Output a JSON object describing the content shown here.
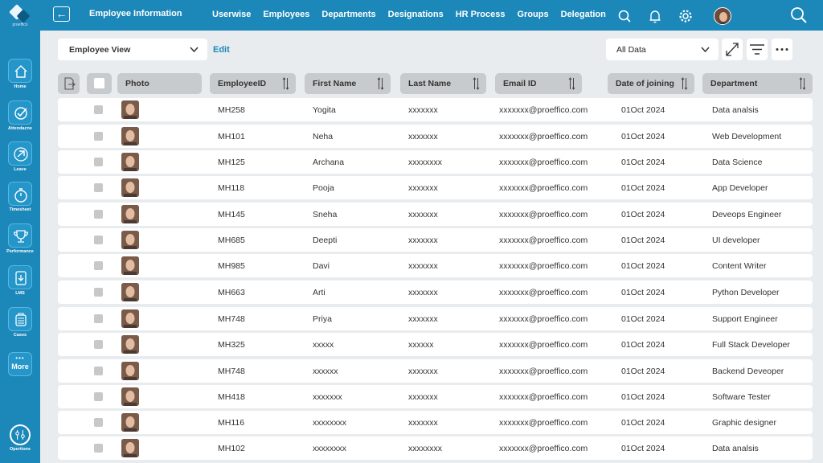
{
  "sidebar": {
    "logo_text": "proeffico",
    "items": [
      {
        "label": "Home",
        "icon": "home-icon"
      },
      {
        "label": "Attendacne",
        "icon": "attendance-check-icon"
      },
      {
        "label": "Leave",
        "icon": "plane-icon"
      },
      {
        "label": "Timesheet",
        "icon": "stopwatch-icon"
      },
      {
        "label": "Performance",
        "icon": "trophy-icon"
      },
      {
        "label": "LMS",
        "icon": "download-icon"
      },
      {
        "label": "Cases",
        "icon": "briefcase-icon"
      }
    ],
    "more_label": "More",
    "operations_label": "Opertions"
  },
  "topbar": {
    "title": "Employee Information",
    "nav": [
      "Userwise",
      "Employees",
      "Departments",
      "Designations",
      "HR Process",
      "Groups",
      "Delegation"
    ]
  },
  "toolbar": {
    "view_select": "Employee View",
    "edit_label": "Edit",
    "data_select": "All Data"
  },
  "table": {
    "headers": [
      "Photo",
      "EmployeeID",
      "First Name",
      "Last Name",
      "Email ID",
      "Date of joining",
      "Department"
    ],
    "rows": [
      {
        "id": "MH258",
        "first": "Yogita",
        "last": "xxxxxxx",
        "email": "xxxxxxx@proeffico.com",
        "doj": "01Oct 2024",
        "dept": "Data analsis"
      },
      {
        "id": "MH101",
        "first": "Neha",
        "last": "xxxxxxx",
        "email": "xxxxxxx@proeffico.com",
        "doj": "01Oct 2024",
        "dept": "Web Development"
      },
      {
        "id": "MH125",
        "first": "Archana",
        "last": "xxxxxxxx",
        "email": "xxxxxxx@proeffico.com",
        "doj": "01Oct 2024",
        "dept": "Data Science"
      },
      {
        "id": "MH118",
        "first": "Pooja",
        "last": "xxxxxxx",
        "email": "xxxxxxx@proeffico.com",
        "doj": "01Oct 2024",
        "dept": "App Developer"
      },
      {
        "id": "MH145",
        "first": "Sneha",
        "last": "xxxxxxx",
        "email": "xxxxxxx@proeffico.com",
        "doj": "01Oct 2024",
        "dept": "Deveops Engineer"
      },
      {
        "id": "MH685",
        "first": "Deepti",
        "last": "xxxxxxx",
        "email": "xxxxxxx@proeffico.com",
        "doj": "01Oct 2024",
        "dept": "UI developer"
      },
      {
        "id": "MH985",
        "first": "Davi",
        "last": "xxxxxxx",
        "email": "xxxxxxx@proeffico.com",
        "doj": "01Oct 2024",
        "dept": "Content Writer"
      },
      {
        "id": "MH663",
        "first": "Arti",
        "last": "xxxxxxx",
        "email": "xxxxxxx@proeffico.com",
        "doj": "01Oct 2024",
        "dept": "Python Developer"
      },
      {
        "id": "MH748",
        "first": "Priya",
        "last": "xxxxxxx",
        "email": "xxxxxxx@proeffico.com",
        "doj": "01Oct 2024",
        "dept": "Support Engineer"
      },
      {
        "id": "MH325",
        "first": "xxxxx",
        "last": "xxxxxx",
        "email": "xxxxxxx@proeffico.com",
        "doj": "01Oct 2024",
        "dept": "Full Stack Developer"
      },
      {
        "id": "MH748",
        "first": "xxxxxx",
        "last": "xxxxxxx",
        "email": "xxxxxxx@proeffico.com",
        "doj": "01Oct 2024",
        "dept": "Backend Deveoper"
      },
      {
        "id": "MH418",
        "first": "xxxxxxx",
        "last": "xxxxxxx",
        "email": "xxxxxxx@proeffico.com",
        "doj": "01Oct 2024",
        "dept": "Software Tester"
      },
      {
        "id": "MH116",
        "first": "xxxxxxxx",
        "last": "xxxxxxx",
        "email": "xxxxxxx@proeffico.com",
        "doj": "01Oct 2024",
        "dept": "Graphic designer"
      },
      {
        "id": "MH102",
        "first": "xxxxxxxx",
        "last": "xxxxxxxx",
        "email": "xxxxxxx@proeffico.com",
        "doj": "01Oct 2024",
        "dept": "Data analsis"
      }
    ]
  },
  "colors": {
    "primary": "#1c87b9",
    "background": "#e9ecef",
    "header_cell": "#c8cbcd"
  }
}
